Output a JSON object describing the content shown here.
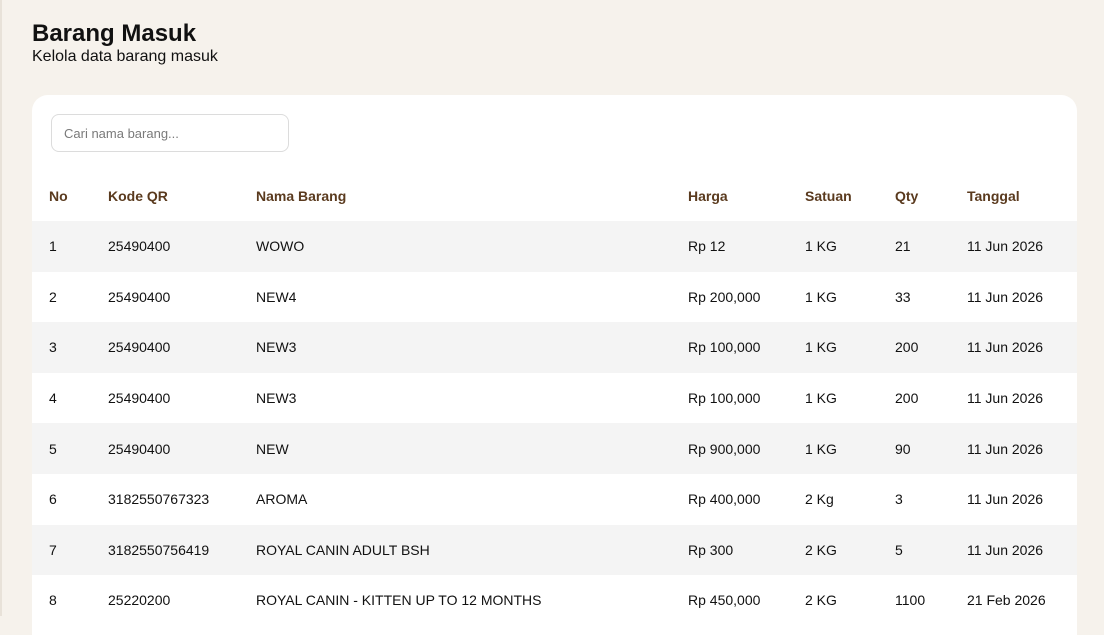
{
  "header": {
    "title": "Barang Masuk",
    "subtitle": "Kelola data barang masuk"
  },
  "search": {
    "placeholder": "Cari nama barang...",
    "value": ""
  },
  "table": {
    "columns": [
      "No",
      "Kode QR",
      "Nama Barang",
      "Harga",
      "Satuan",
      "Qty",
      "Tanggal"
    ],
    "rows": [
      {
        "no": "1",
        "kode": "25490400",
        "nama": "WOWO",
        "harga": "Rp 12",
        "satuan": "1 KG",
        "qty": "21",
        "tanggal": "11 Jun 2026"
      },
      {
        "no": "2",
        "kode": "25490400",
        "nama": "NEW4",
        "harga": "Rp 200,000",
        "satuan": "1 KG",
        "qty": "33",
        "tanggal": "11 Jun 2026"
      },
      {
        "no": "3",
        "kode": "25490400",
        "nama": "NEW3",
        "harga": "Rp 100,000",
        "satuan": "1 KG",
        "qty": "200",
        "tanggal": "11 Jun 2026"
      },
      {
        "no": "4",
        "kode": "25490400",
        "nama": "NEW3",
        "harga": "Rp 100,000",
        "satuan": "1 KG",
        "qty": "200",
        "tanggal": "11 Jun 2026"
      },
      {
        "no": "5",
        "kode": "25490400",
        "nama": "NEW",
        "harga": "Rp 900,000",
        "satuan": "1 KG",
        "qty": "90",
        "tanggal": "11 Jun 2026"
      },
      {
        "no": "6",
        "kode": "3182550767323",
        "nama": "AROMA",
        "harga": "Rp 400,000",
        "satuan": "2 Kg",
        "qty": "3",
        "tanggal": "11 Jun 2026"
      },
      {
        "no": "7",
        "kode": "3182550756419",
        "nama": "ROYAL CANIN ADULT BSH",
        "harga": "Rp 300",
        "satuan": "2 KG",
        "qty": "5",
        "tanggal": "11 Jun 2026"
      },
      {
        "no": "8",
        "kode": "25220200",
        "nama": "ROYAL CANIN - KITTEN UP TO 12 MONTHS",
        "harga": "Rp 450,000",
        "satuan": "2 KG",
        "qty": "1100",
        "tanggal": "21 Feb 2026"
      }
    ]
  },
  "colors": {
    "background": "#f6f2ec",
    "header_text": "#5a3a1e",
    "row_stripe": "#f4f4f4"
  }
}
